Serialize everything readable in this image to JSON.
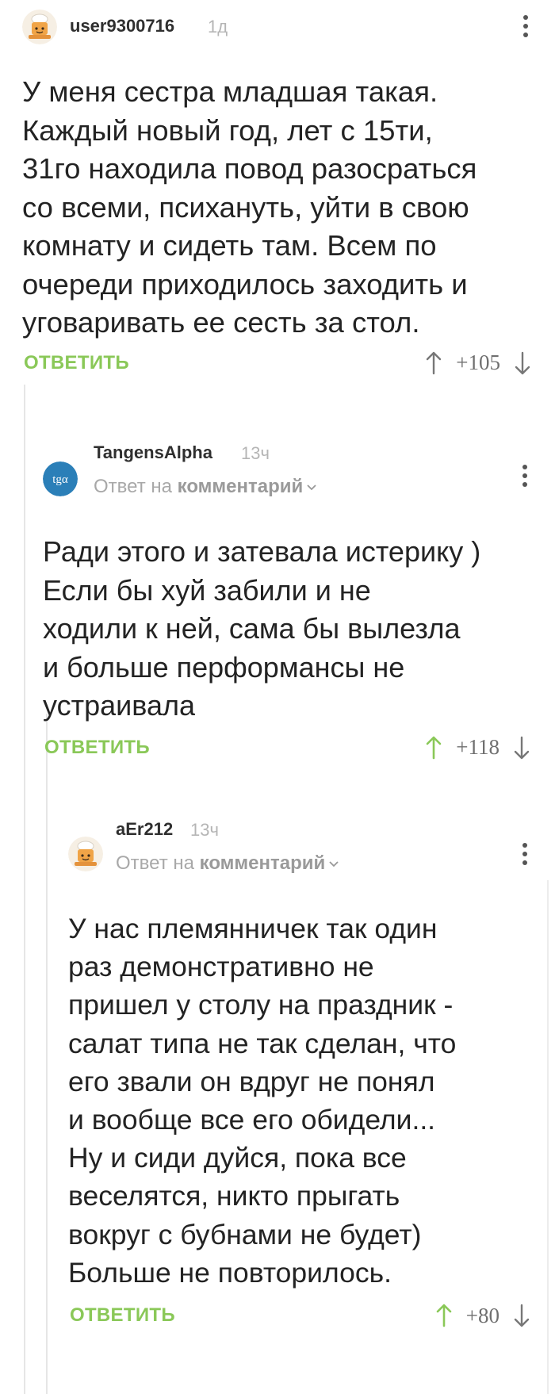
{
  "comments": [
    {
      "username": "user9300716",
      "time": "1д",
      "text": "У меня сестра младшая такая.\nКаждый новый год, лет с 15ти,\n31го находила повод разосраться\nсо всеми, психануть, уйти в свою\nкомнату и сидеть там. Всем по\nочереди приходилось заходить и\nуговаривать ее сесть за стол.",
      "reply_label": "ОТВЕТИТЬ",
      "rating": "+105"
    },
    {
      "username": "TangensAlpha",
      "time": "13ч",
      "avatar_text": "tgα",
      "reply_to_prefix": "Ответ на",
      "reply_to_target": "комментарий",
      "text": "Ради этого и затевала истерику )\nЕсли бы хуй забили и не\nходили к ней, сама бы вылезла\nи больше перформансы не\nустраивала",
      "reply_label": "ОТВЕТИТЬ",
      "rating": "+118"
    },
    {
      "username": "aEr212",
      "time": "13ч",
      "reply_to_prefix": "Ответ на",
      "reply_to_target": "комментарий",
      "text": "У нас племянничек так один\nраз демонстративно не\nпришел у столу на праздник -\nсалат типа не так сделан, что\nего звали он вдруг не понял\nи вообще все его обидели...\nНу и сиди дуйся, пока все\nвеселятся, никто прыгать\nвокруг с бубнами не будет)\nБольше не повторилось.",
      "reply_label": "ОТВЕТИТЬ",
      "rating": "+80"
    }
  ],
  "icons": {
    "avatar_default": "baker-avatar-icon",
    "more": "more-vertical-icon",
    "upvote": "arrow-up-icon",
    "downvote": "arrow-down-icon",
    "chevron": "chevron-down-icon"
  },
  "colors": {
    "accent": "#8ac858",
    "upvote_active": "#8ac858",
    "tangens_avatar_bg": "#2b7fb8"
  }
}
